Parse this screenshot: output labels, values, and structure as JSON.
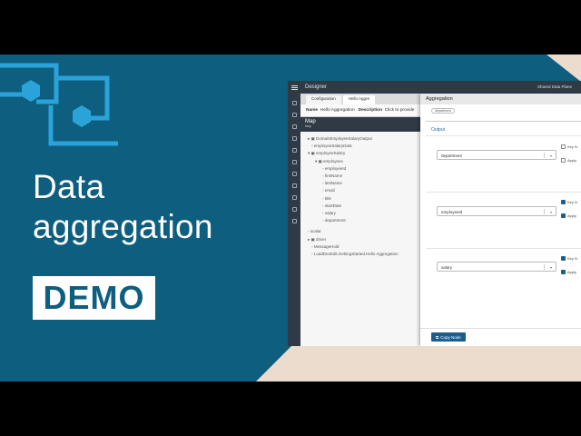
{
  "slide": {
    "title_line1": "Data",
    "title_line2": "aggregation",
    "badge": "DEMO"
  },
  "colors": {
    "brand": "#0e5e7f",
    "accent": "#1c5e8a",
    "beige": "#ecdccd"
  },
  "app": {
    "window_title": "Designer",
    "top_right": "Shared Data Plane",
    "tabs": [
      "Configuration",
      "Hello Aggre"
    ],
    "name_label": "Name",
    "name_value": "Hello Aggregation",
    "description_label": "Description",
    "description_value": "Click to provide",
    "map_title": "Map",
    "map_sub": "Map",
    "tree": [
      "DomainEmployeeSalaryOutput",
      "employeeSalaryData",
      "employeeSalary",
      "employees",
      "employeeId",
      "firstName",
      "lastName",
      "email",
      "title",
      "startDate",
      "salary",
      "department",
      "scalar",
      "driver",
      "MessageHold",
      "LoadDesEdit.GettingStarted.Hello Aggregation"
    ]
  },
  "panel": {
    "title": "Aggregation",
    "chip": "department",
    "output_label": "Output",
    "rows": [
      {
        "value": "department",
        "key_label": "Key N",
        "apply_label": "Apply",
        "key_checked": false,
        "apply_checked": false
      },
      {
        "value": "employeeId",
        "key_label": "Key N",
        "apply_label": "Apply",
        "key_checked": true,
        "apply_checked": true
      },
      {
        "value": "salary",
        "key_label": "Key N",
        "apply_label": "Apply",
        "key_checked": true,
        "apply_checked": true
      }
    ],
    "copy_button": "Copy Node"
  }
}
